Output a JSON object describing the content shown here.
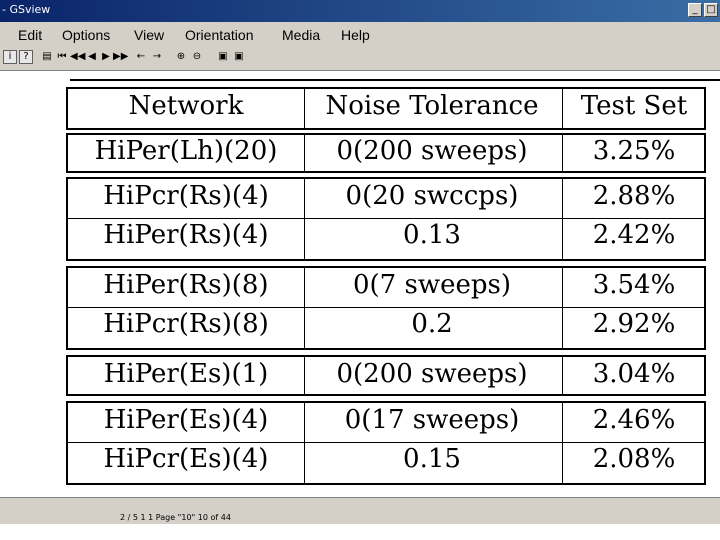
{
  "window": {
    "title": "- GSview"
  },
  "menu": [
    "Edit",
    "Options",
    "View",
    "Orientation",
    "Media",
    "Help"
  ],
  "toolbar_buttons": [
    "i",
    "?"
  ],
  "table": {
    "headers": [
      "Network",
      "Noise Tolerance",
      "Test Set"
    ],
    "groups": [
      [
        [
          "HiPer(Lh)(20)",
          "0(200 sweeps)",
          "3.25%"
        ]
      ],
      [
        [
          "HiPcr(Rs)(4)",
          "0(20 swccps)",
          "2.88%"
        ],
        [
          "HiPer(Rs)(4)",
          "0.13",
          "2.42%"
        ]
      ],
      [
        [
          "HiPer(Rs)(8)",
          "0(7 sweeps)",
          "3.54%"
        ],
        [
          "HiPcr(Rs)(8)",
          "0.2",
          "2.92%"
        ]
      ],
      [
        [
          "HiPer(Es)(1)",
          "0(200 sweeps)",
          "3.04%"
        ]
      ],
      [
        [
          "HiPer(Es)(4)",
          "0(17 sweeps)",
          "2.46%"
        ],
        [
          "HiPcr(Es)(4)",
          "0.15",
          "2.08%"
        ]
      ]
    ]
  },
  "status": "2 / 5 1 1 Page \"10\" 10 of 44"
}
